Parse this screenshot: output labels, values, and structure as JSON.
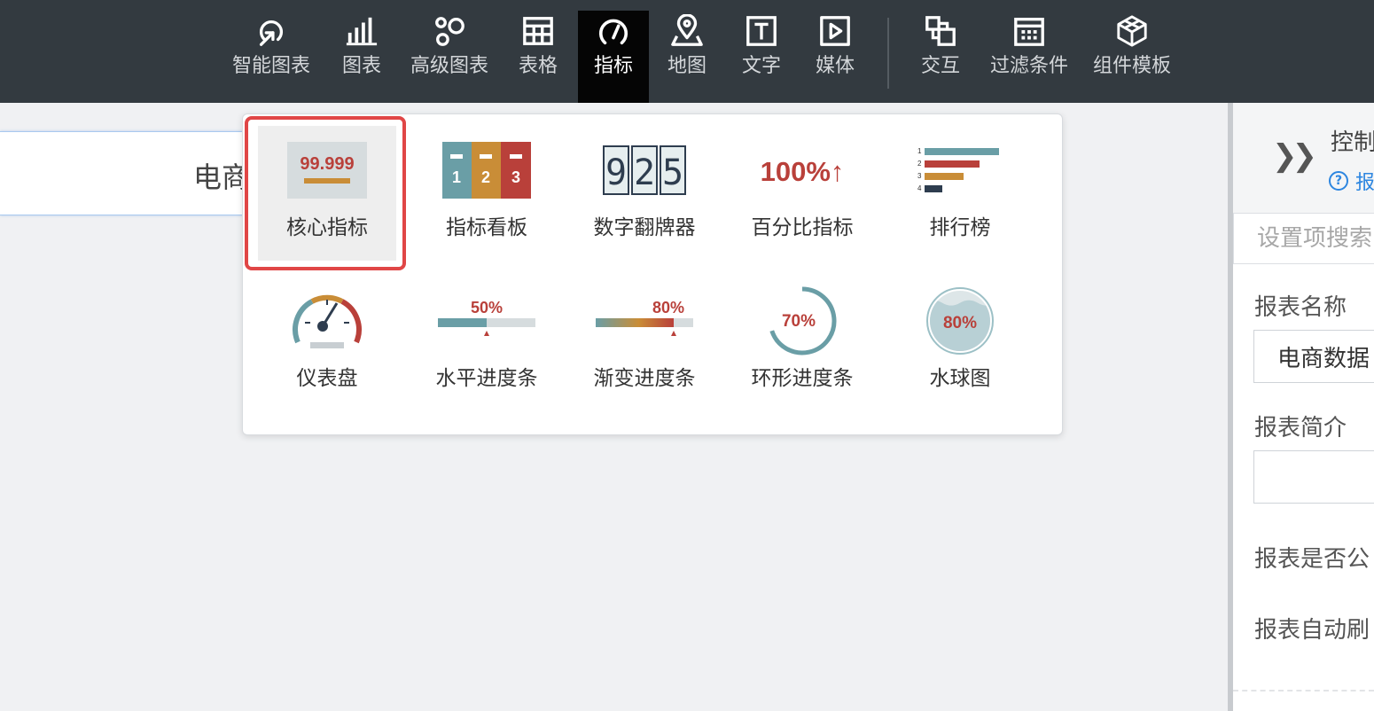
{
  "toolbar": {
    "items": [
      {
        "label": "智能图表",
        "icon": "smart-chart-icon"
      },
      {
        "label": "图表",
        "icon": "bar-chart-icon"
      },
      {
        "label": "高级图表",
        "icon": "advanced-chart-icon"
      },
      {
        "label": "表格",
        "icon": "table-icon"
      },
      {
        "label": "指标",
        "icon": "gauge-icon",
        "active": true
      },
      {
        "label": "地图",
        "icon": "map-pin-icon"
      },
      {
        "label": "文字",
        "icon": "text-icon"
      },
      {
        "label": "媒体",
        "icon": "media-play-icon"
      },
      {
        "label": "交互",
        "icon": "interaction-icon"
      },
      {
        "label": "过滤条件",
        "icon": "filter-calendar-icon"
      },
      {
        "label": "组件模板",
        "icon": "component-cube-icon"
      }
    ]
  },
  "canvas": {
    "report_title": "电商"
  },
  "dropdown": {
    "items": [
      {
        "label": "核心指标",
        "icon": "core-metric-icon",
        "sample": "99.999",
        "selected": true
      },
      {
        "label": "指标看板",
        "icon": "metric-board-icon",
        "digits": [
          "1",
          "2",
          "3"
        ]
      },
      {
        "label": "数字翻牌器",
        "icon": "flip-counter-icon",
        "digits": [
          "9",
          "2",
          "5"
        ]
      },
      {
        "label": "百分比指标",
        "icon": "percent-metric-icon",
        "sample": "100%↑"
      },
      {
        "label": "排行榜",
        "icon": "ranking-icon",
        "ranks": [
          "1",
          "2",
          "3",
          "4"
        ]
      },
      {
        "label": "仪表盘",
        "icon": "dial-gauge-icon"
      },
      {
        "label": "水平进度条",
        "icon": "horizontal-progress-icon",
        "sample": "50%",
        "progress": 0.5
      },
      {
        "label": "渐变进度条",
        "icon": "gradient-progress-icon",
        "sample": "80%",
        "progress": 0.8
      },
      {
        "label": "环形进度条",
        "icon": "ring-progress-icon",
        "sample": "70%",
        "progress": 0.7
      },
      {
        "label": "水球图",
        "icon": "liquid-ball-icon",
        "sample": "80%",
        "progress": 0.8
      }
    ]
  },
  "right_panel": {
    "collapse_icon": "double-chevron-right-icon",
    "title": "控制",
    "help": "报",
    "search_placeholder": "设置项搜索",
    "fields": [
      {
        "label": "报表名称",
        "value": "电商数据"
      },
      {
        "label": "报表简介",
        "value": ""
      },
      {
        "label": "报表是否公",
        "value": ""
      },
      {
        "label": "报表自动刷",
        "value": ""
      }
    ]
  },
  "colors": {
    "toolbar_bg": "#333a40",
    "active_bg": "#050505",
    "teal": "#6a9ea6",
    "gold": "#c98d37",
    "red": "#b9403a",
    "navy": "#2e3d4f",
    "highlight": "#e04646",
    "link": "#2d86e0"
  }
}
